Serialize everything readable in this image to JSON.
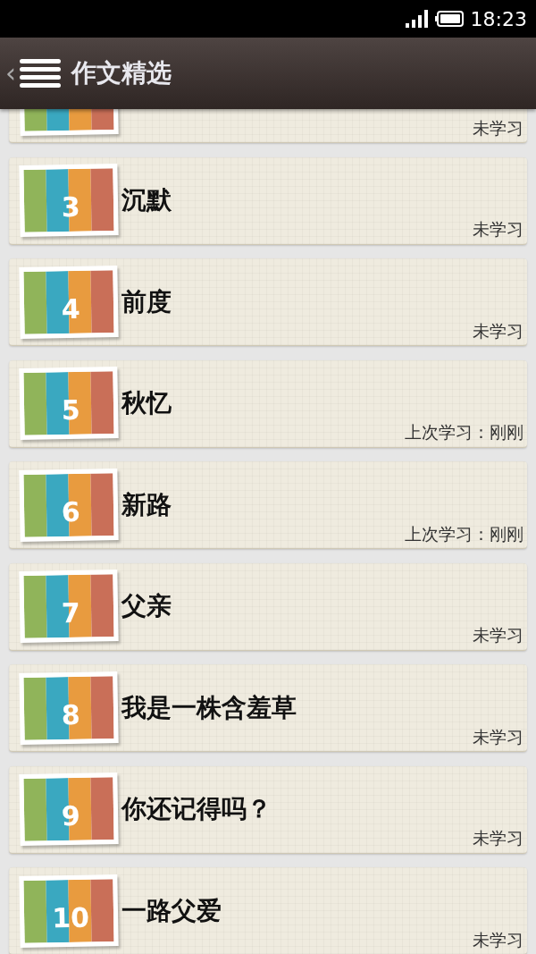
{
  "status_bar": {
    "time": "18:23"
  },
  "header": {
    "back": "‹",
    "title": "作文精选"
  },
  "items": [
    {
      "status": "未学习"
    },
    {
      "number": "3",
      "title": "沉默",
      "status": "未学习"
    },
    {
      "number": "4",
      "title": "前度",
      "status": "未学习"
    },
    {
      "number": "5",
      "title": "秋忆",
      "status": "上次学习：刚刚"
    },
    {
      "number": "6",
      "title": "新路",
      "status": "上次学习：刚刚"
    },
    {
      "number": "7",
      "title": "父亲",
      "status": "未学习"
    },
    {
      "number": "8",
      "title": "我是一株含羞草",
      "status": "未学习"
    },
    {
      "number": "9",
      "title": "你还记得吗？",
      "status": "未学习"
    },
    {
      "number": "10",
      "title": "一路父爱",
      "status": "未学习"
    }
  ]
}
